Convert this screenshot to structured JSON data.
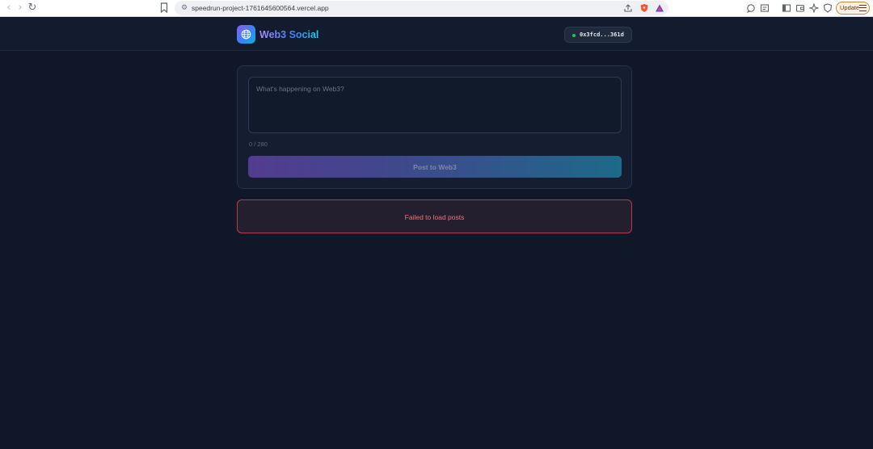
{
  "browser": {
    "url": "speedrun-project-1761645600564.vercel.app",
    "update_label": "Update",
    "icons": {
      "back": "back-arrow-icon",
      "forward": "forward-arrow-icon",
      "reload": "reload-icon",
      "bookmark": "bookmark-icon",
      "site_info": "site-settings-icon",
      "share": "share-icon",
      "brave": "brave-shield-icon",
      "rewards": "brave-rewards-icon",
      "extensions": [
        "chat-icon",
        "reader-icon",
        "sidebar-icon",
        "wallet-icon",
        "leo-ai-icon",
        "vpn-icon"
      ],
      "menu": "hamburger-menu-icon"
    }
  },
  "app": {
    "brand": "Web3 Social",
    "logo_icon": "globe-icon",
    "wallet": {
      "address": "0x3fcd...361d",
      "status_color": "#22c55e"
    }
  },
  "composer": {
    "placeholder": "What's happening on Web3?",
    "value": "",
    "char_count": "0 / 280",
    "post_button_label": "Post to Web3"
  },
  "feed": {
    "error_message": "Failed to load posts"
  },
  "colors": {
    "background": "#0f1729",
    "accent_purple": "#8b5cf6",
    "accent_cyan": "#06b6d4",
    "error": "#f87171"
  }
}
